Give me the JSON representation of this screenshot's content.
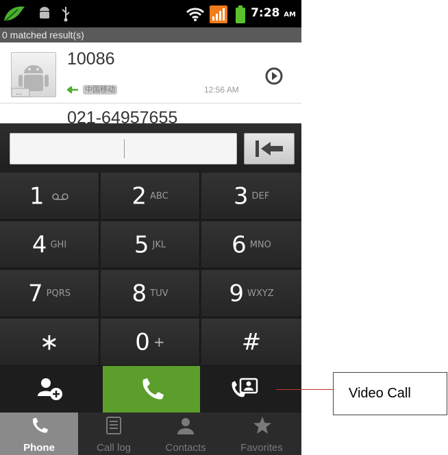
{
  "status_bar": {
    "time": "7:28",
    "ampm": "AM"
  },
  "search": {
    "matched_text": "0 matched result(s)"
  },
  "results": [
    {
      "number": "10086",
      "carrier": "中国移动",
      "time": "12:56 AM"
    },
    {
      "number": "021-64957655"
    }
  ],
  "keypad": [
    {
      "main": "1",
      "sub": ""
    },
    {
      "main": "2",
      "sub": "ABC"
    },
    {
      "main": "3",
      "sub": "DEF"
    },
    {
      "main": "4",
      "sub": "GHI"
    },
    {
      "main": "5",
      "sub": "JKL"
    },
    {
      "main": "6",
      "sub": "MNO"
    },
    {
      "main": "7",
      "sub": "PQRS"
    },
    {
      "main": "8",
      "sub": "TUV"
    },
    {
      "main": "9",
      "sub": "WXYZ"
    },
    {
      "main": "∗",
      "sub": ""
    },
    {
      "main": "0",
      "sub": "+"
    },
    {
      "main": "#",
      "sub": ""
    }
  ],
  "icons": {
    "statusbar_left": [
      "leaf-icon",
      "android-icon",
      "usb-icon"
    ],
    "statusbar_right": [
      "wifi-icon",
      "signal-icon",
      "battery-icon"
    ],
    "voicemail": "voicemail-icon",
    "backspace": "backspace-icon",
    "add_contact": "add-contact-icon",
    "call": "phone-icon",
    "video_call": "video-call-icon",
    "play": "play-icon"
  },
  "colors": {
    "call_green": "#5c9e2b",
    "callout_line": "#c0392b",
    "active_tab": "#8a8a8a",
    "signal_orange": "#f07c1b",
    "battery_green": "#5cc12c"
  },
  "tabs": [
    {
      "label": "Phone",
      "active": true
    },
    {
      "label": "Call log",
      "active": false
    },
    {
      "label": "Contacts",
      "active": false
    },
    {
      "label": "Favorites",
      "active": false
    }
  ],
  "annotation": {
    "label": "Video Call"
  }
}
